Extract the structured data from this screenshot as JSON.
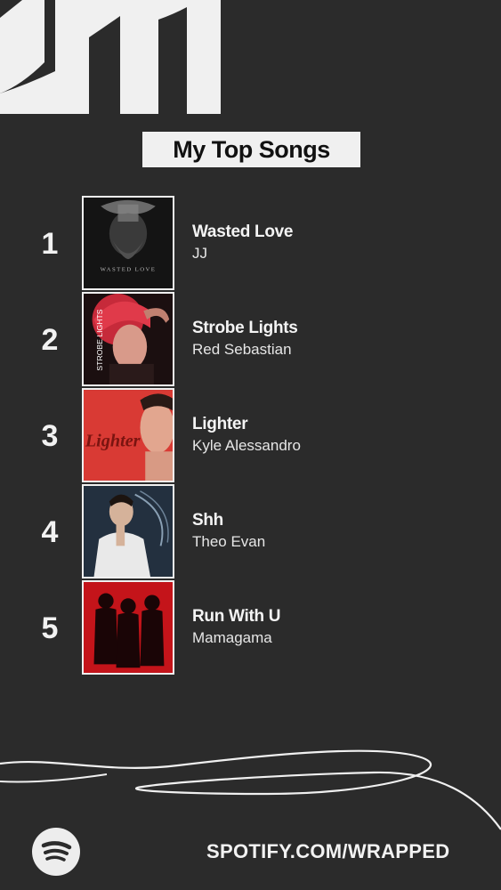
{
  "header": {
    "title": "My Top Songs"
  },
  "songs": [
    {
      "rank": "1",
      "title": "Wasted Love",
      "artist": "JJ",
      "cover_text": "WASTED LOVE"
    },
    {
      "rank": "2",
      "title": "Strobe Lights",
      "artist": "Red Sebastian",
      "cover_text": "STROBE LIGHTS"
    },
    {
      "rank": "3",
      "title": "Lighter",
      "artist": "Kyle Alessandro",
      "cover_text": "Lighter"
    },
    {
      "rank": "4",
      "title": "Shh",
      "artist": "Theo Evan"
    },
    {
      "rank": "5",
      "title": "Run With U",
      "artist": "Mamagama"
    }
  ],
  "footer": {
    "url": "SPOTIFY.COM/WRAPPED",
    "logo_icon": "spotify-icon"
  },
  "colors": {
    "background": "#2b2b2b",
    "foreground": "#f0f0f0",
    "accent_red": "#d93a34"
  }
}
